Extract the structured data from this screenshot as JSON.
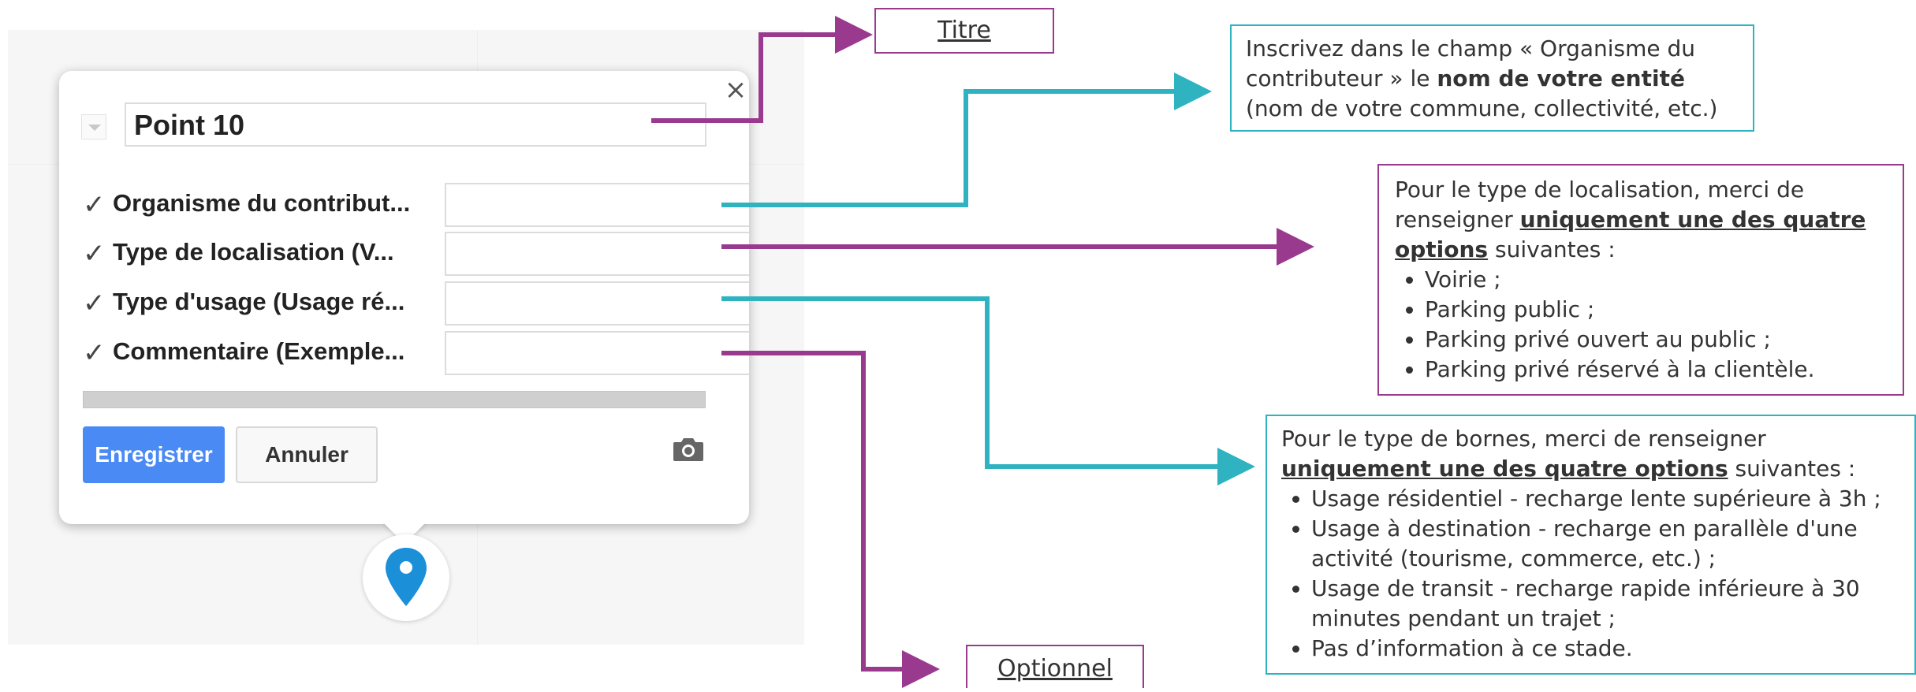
{
  "popup": {
    "close_glyph": "×",
    "title_value": "Point 10",
    "fields": [
      {
        "label": "Organisme du contribut...",
        "value": ""
      },
      {
        "label": "Type de localisation (V...",
        "value": ""
      },
      {
        "label": "Type d'usage (Usage ré...",
        "value": ""
      },
      {
        "label": "Commentaire (Exemple...",
        "value": ""
      }
    ],
    "save_label": "Enregistrer",
    "cancel_label": "Annuler"
  },
  "annotations": {
    "titre": "Titre",
    "optionnel": "Optionnel",
    "organisme": {
      "line1_pre": "Inscrivez dans le champ « Organisme du contributeur » le ",
      "bold": "nom de votre entité",
      "line2": "(nom de votre commune, collectivité, etc.)"
    },
    "localisation": {
      "intro_pre": "Pour le type de localisation, merci de renseigner ",
      "intro_emph": "uniquement une des quatre options",
      "intro_post": " suivantes :",
      "options": [
        "Voirie ;",
        "Parking public ;",
        "Parking privé ouvert au public ;",
        "Parking privé réservé à la clientèle."
      ]
    },
    "bornes": {
      "intro_pre": "Pour le type de bornes, merci de renseigner ",
      "intro_emph": "uniquement une des quatre options",
      "intro_post": " suivantes :",
      "options": [
        "Usage résidentiel - recharge lente supérieure à 3h ;",
        "Usage à destination - recharge en parallèle d'une activité (tourisme, commerce, etc.) ;",
        "Usage de transit - recharge rapide inférieure à 30 minutes pendant un trajet ;",
        "Pas d’information à ce stade."
      ]
    }
  },
  "colors": {
    "purple": "#9a3a8f",
    "teal": "#2fb3c1",
    "save_blue": "#4a8af4",
    "marker_blue": "#1b8fd8"
  },
  "icons": [
    "close-icon",
    "dropdown-icon",
    "check-icon",
    "camera-icon",
    "map-pin-icon"
  ]
}
